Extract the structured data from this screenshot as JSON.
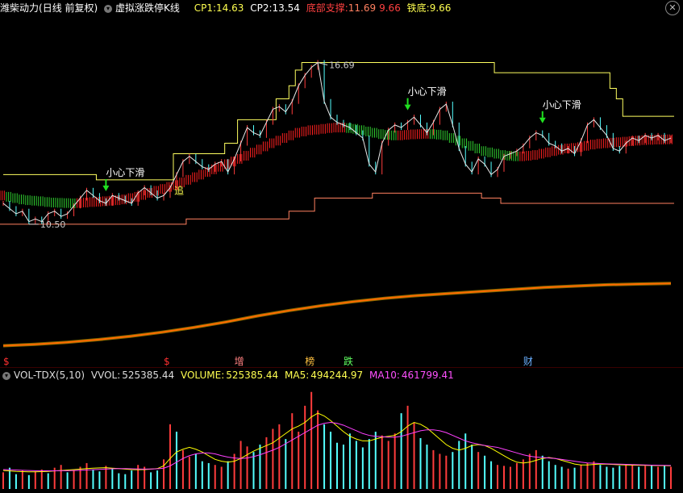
{
  "header": {
    "stock_name": "潍柴动力",
    "period": "(日线 前复权)",
    "indicator_name": "虚拟涨跌停K线",
    "cp1_label": "CP1:",
    "cp1_value": "14.63",
    "cp2_label": "CP2:",
    "cp2_value": "13.54",
    "support_label": "底部支撑:",
    "support_value1": "11.69",
    "support_value2": "9.66",
    "iron_label": "铁底:",
    "iron_value": "9.66"
  },
  "volume_header": {
    "title": "VOL-TDX(5,10)",
    "vvol_label": "VVOL:",
    "vvol_value": "525385.44",
    "volume_label": "VOLUME:",
    "volume_value": "525385.44",
    "ma5_label": "MA5:",
    "ma5_value": "494244.97",
    "ma10_label": "MA10:",
    "ma10_value": "461799.41"
  },
  "colors": {
    "up": "#ff3c3c",
    "down": "#54ffff",
    "ma_up": "#ff2020",
    "ma_down": "#30d030",
    "upper_band": "#ffff60",
    "lower_band": "#ff8060",
    "trend": "#ff6a00",
    "ma5": "#ffff00",
    "ma10": "#ff40ff"
  },
  "chart_data": [
    {
      "type": "line",
      "title": "虚拟涨跌停K线",
      "ylim": [
        9.2,
        17.6
      ],
      "grid": false,
      "price_series": [
        11.3,
        11.1,
        10.9,
        11.0,
        10.6,
        10.7,
        10.6,
        10.9,
        11.0,
        10.8,
        10.9,
        11.2,
        11.5,
        11.8,
        11.6,
        11.4,
        11.3,
        11.6,
        11.5,
        11.4,
        11.3,
        11.7,
        11.9,
        11.7,
        11.5,
        11.6,
        11.9,
        12.4,
        12.9,
        13.1,
        12.9,
        12.7,
        12.6,
        12.8,
        12.9,
        12.5,
        13.0,
        13.6,
        14.2,
        14.0,
        13.9,
        14.4,
        14.9,
        15.0,
        14.8,
        15.2,
        15.8,
        16.2,
        16.5,
        16.69,
        15.2,
        14.6,
        14.4,
        14.3,
        14.2,
        14.0,
        13.8,
        12.8,
        12.5,
        13.6,
        14.1,
        14.3,
        14.2,
        14.4,
        14.6,
        14.3,
        14.0,
        14.4,
        14.9,
        15.1,
        14.3,
        13.4,
        12.8,
        12.5,
        13.0,
        12.8,
        12.4,
        12.6,
        13.1,
        13.2,
        13.3,
        13.5,
        13.8,
        14.0,
        13.9,
        13.6,
        13.5,
        13.3,
        13.4,
        13.2,
        13.7,
        14.3,
        14.5,
        14.2,
        13.9,
        13.4,
        13.3,
        13.6,
        13.8,
        13.7,
        13.9,
        13.8,
        13.9,
        13.7,
        13.8
      ],
      "ma_series": [
        11.6,
        11.55,
        11.5,
        11.45,
        11.42,
        11.4,
        11.38,
        11.35,
        11.33,
        11.32,
        11.31,
        11.3,
        11.31,
        11.33,
        11.35,
        11.36,
        11.38,
        11.4,
        11.42,
        11.45,
        11.5,
        11.55,
        11.62,
        11.7,
        11.78,
        11.85,
        11.93,
        12.0,
        12.1,
        12.2,
        12.3,
        12.4,
        12.5,
        12.6,
        12.7,
        12.8,
        12.9,
        13.0,
        13.12,
        13.24,
        13.36,
        13.48,
        13.6,
        13.7,
        13.8,
        13.9,
        14.0,
        14.05,
        14.1,
        14.12,
        14.15,
        14.18,
        14.2,
        14.2,
        14.18,
        14.15,
        14.1,
        14.05,
        14.0,
        13.95,
        13.92,
        13.9,
        13.9,
        13.92,
        13.94,
        13.95,
        13.96,
        13.95,
        13.93,
        13.9,
        13.8,
        13.7,
        13.6,
        13.5,
        13.4,
        13.3,
        13.25,
        13.2,
        13.15,
        13.12,
        13.1,
        13.1,
        13.12,
        13.15,
        13.2,
        13.25,
        13.3,
        13.35,
        13.4,
        13.42,
        13.45,
        13.5,
        13.55,
        13.58,
        13.6,
        13.62,
        13.64,
        13.66,
        13.68,
        13.7,
        13.72,
        13.73,
        13.74,
        13.74,
        13.75
      ],
      "upper_band": [
        12.4,
        12.4,
        12.4,
        12.4,
        12.4,
        12.4,
        12.4,
        12.4,
        12.4,
        12.4,
        12.4,
        12.4,
        12.4,
        12.4,
        12.4,
        12.2,
        12.2,
        12.2,
        12.2,
        12.2,
        12.2,
        12.2,
        12.2,
        12.2,
        12.2,
        12.2,
        12.2,
        13.2,
        13.2,
        13.2,
        13.2,
        13.2,
        13.2,
        13.2,
        13.2,
        13.6,
        13.6,
        14.5,
        14.5,
        14.5,
        14.5,
        14.5,
        14.5,
        15.3,
        15.3,
        15.8,
        16.4,
        16.69,
        16.69,
        16.69,
        16.69,
        16.69,
        16.69,
        16.69,
        16.69,
        16.69,
        16.69,
        16.69,
        16.69,
        16.69,
        16.69,
        16.69,
        16.69,
        16.69,
        16.69,
        16.69,
        16.69,
        16.69,
        16.69,
        16.69,
        16.69,
        16.69,
        16.69,
        16.69,
        16.69,
        16.69,
        16.69,
        16.3,
        16.3,
        16.3,
        16.3,
        16.3,
        16.3,
        16.3,
        16.3,
        16.3,
        16.3,
        16.3,
        16.3,
        16.3,
        16.3,
        16.3,
        16.3,
        16.3,
        16.3,
        15.7,
        15.3,
        14.63,
        14.63,
        14.63,
        14.63,
        14.63,
        14.63,
        14.63,
        14.63
      ],
      "lower_band": [
        10.5,
        10.5,
        10.5,
        10.5,
        10.5,
        10.5,
        10.5,
        10.5,
        10.5,
        10.5,
        10.5,
        10.5,
        10.5,
        10.5,
        10.5,
        10.5,
        10.5,
        10.5,
        10.5,
        10.5,
        10.5,
        10.5,
        10.5,
        10.5,
        10.5,
        10.5,
        10.5,
        10.5,
        10.5,
        10.7,
        10.7,
        10.7,
        10.7,
        10.7,
        10.7,
        10.7,
        10.7,
        10.7,
        10.7,
        10.7,
        10.7,
        10.7,
        10.7,
        10.7,
        10.7,
        11.0,
        11.0,
        11.0,
        11.0,
        11.5,
        11.5,
        11.5,
        11.5,
        11.5,
        11.5,
        11.5,
        11.5,
        11.5,
        11.69,
        11.69,
        11.69,
        11.69,
        11.69,
        11.69,
        11.69,
        11.69,
        11.69,
        11.69,
        11.69,
        11.69,
        11.69,
        11.69,
        11.69,
        11.69,
        11.69,
        11.5,
        11.5,
        11.5,
        11.3,
        11.3,
        11.3,
        11.3,
        11.3,
        11.3,
        11.3,
        11.3,
        11.3,
        11.3,
        11.3,
        11.3,
        11.3,
        11.3,
        11.3,
        11.3,
        11.3,
        11.3,
        11.3,
        11.3,
        11.3,
        11.3,
        11.3,
        11.3,
        11.3,
        11.3,
        11.3
      ],
      "trend_ylim": [
        0,
        1
      ],
      "trend_series": [
        0.03,
        0.05,
        0.08,
        0.12,
        0.17,
        0.23,
        0.3,
        0.38,
        0.47,
        0.55,
        0.62,
        0.68,
        0.73,
        0.77,
        0.8,
        0.83,
        0.86,
        0.89,
        0.91,
        0.93,
        0.94,
        0.95
      ],
      "annotations": [
        {
          "text": "小心下滑",
          "index": 16,
          "arrow": true
        },
        {
          "text": "小心下滑",
          "index": 63,
          "arrow": true
        },
        {
          "text": "小心下滑",
          "index": 84,
          "arrow": true
        },
        {
          "text": "16.69",
          "index": 49
        },
        {
          "text": "10.50",
          "index": 4
        },
        {
          "text": "追",
          "index": 27
        }
      ],
      "event_markers": [
        {
          "text": "$",
          "index": 0,
          "color": "#ff3030"
        },
        {
          "text": "$",
          "index": 25,
          "color": "#ff3030"
        },
        {
          "text": "增",
          "index": 36,
          "color": "#ff8080"
        },
        {
          "text": "榜",
          "index": 47,
          "color": "#ffc040"
        },
        {
          "text": "跌",
          "index": 53,
          "color": "#60ff60"
        },
        {
          "text": "财",
          "index": 81,
          "color": "#6ab0ff"
        }
      ]
    },
    {
      "type": "bar",
      "title": "VOL-TDX(5,10)",
      "ylim": [
        0,
        1100000
      ],
      "volume": [
        180000,
        230000,
        160000,
        200000,
        150000,
        190000,
        210000,
        170000,
        230000,
        260000,
        180000,
        200000,
        240000,
        280000,
        210000,
        190000,
        250000,
        220000,
        170000,
        160000,
        200000,
        260000,
        240000,
        180000,
        200000,
        320000,
        700000,
        620000,
        420000,
        350000,
        380000,
        300000,
        280000,
        260000,
        240000,
        300000,
        380000,
        520000,
        460000,
        400000,
        480000,
        560000,
        650000,
        700000,
        540000,
        820000,
        620000,
        900000,
        1050000,
        850000,
        700000,
        620000,
        500000,
        480000,
        600000,
        520000,
        450000,
        540000,
        620000,
        580000,
        520000,
        600000,
        820000,
        900000,
        720000,
        550000,
        480000,
        420000,
        380000,
        360000,
        400000,
        520000,
        600000,
        480000,
        400000,
        360000,
        300000,
        260000,
        250000,
        240000,
        280000,
        320000,
        380000,
        420000,
        360000,
        300000,
        260000,
        240000,
        220000,
        230000,
        260000,
        280000,
        300000,
        260000,
        240000,
        230000,
        250000,
        270000,
        260000,
        240000,
        250000,
        260000,
        240000,
        255000,
        240000
      ],
      "up": [
        1,
        0,
        0,
        1,
        0,
        1,
        1,
        0,
        1,
        1,
        0,
        1,
        1,
        1,
        0,
        0,
        1,
        0,
        0,
        0,
        0,
        1,
        1,
        0,
        0,
        1,
        1,
        0,
        1,
        1,
        0,
        0,
        0,
        1,
        1,
        0,
        1,
        1,
        1,
        0,
        0,
        1,
        1,
        1,
        0,
        1,
        1,
        1,
        1,
        1,
        0,
        0,
        0,
        0,
        0,
        0,
        0,
        0,
        0,
        1,
        1,
        1,
        0,
        1,
        1,
        0,
        0,
        1,
        1,
        1,
        0,
        0,
        0,
        0,
        1,
        0,
        0,
        1,
        1,
        1,
        1,
        1,
        1,
        1,
        0,
        0,
        0,
        0,
        1,
        0,
        1,
        1,
        1,
        0,
        0,
        0,
        0,
        1,
        1,
        0,
        1,
        0,
        1,
        0,
        1
      ],
      "series": [
        {
          "name": "MA5",
          "values": [
            200000,
            195000,
            190000,
            188000,
            185000,
            186000,
            188000,
            190000,
            195000,
            200000,
            205000,
            210000,
            215000,
            220000,
            225000,
            228000,
            230000,
            225000,
            220000,
            215000,
            210000,
            208000,
            210000,
            215000,
            220000,
            250000,
            330000,
            400000,
            430000,
            450000,
            430000,
            400000,
            360000,
            320000,
            300000,
            290000,
            300000,
            330000,
            370000,
            410000,
            440000,
            470000,
            500000,
            550000,
            600000,
            650000,
            680000,
            720000,
            780000,
            820000,
            790000,
            740000,
            680000,
            620000,
            570000,
            540000,
            520000,
            520000,
            540000,
            560000,
            570000,
            580000,
            620000,
            680000,
            720000,
            700000,
            660000,
            600000,
            540000,
            480000,
            440000,
            420000,
            440000,
            470000,
            480000,
            470000,
            440000,
            400000,
            360000,
            320000,
            290000,
            280000,
            290000,
            310000,
            330000,
            340000,
            330000,
            310000,
            290000,
            270000,
            260000,
            260000,
            265000,
            270000,
            268000,
            265000,
            262000,
            260000,
            258000,
            256000,
            255000,
            254000,
            253000,
            252000,
            251000
          ]
        },
        {
          "name": "MA10",
          "values": [
            210000,
            208000,
            205000,
            202000,
            200000,
            198000,
            197000,
            196000,
            196000,
            197000,
            198000,
            200000,
            202000,
            205000,
            208000,
            212000,
            215000,
            218000,
            220000,
            220000,
            218000,
            216000,
            215000,
            216000,
            218000,
            225000,
            250000,
            290000,
            330000,
            360000,
            380000,
            390000,
            390000,
            380000,
            360000,
            345000,
            335000,
            330000,
            335000,
            350000,
            370000,
            395000,
            420000,
            450000,
            490000,
            530000,
            570000,
            610000,
            650000,
            690000,
            710000,
            720000,
            710000,
            690000,
            660000,
            630000,
            600000,
            580000,
            570000,
            565000,
            560000,
            560000,
            570000,
            590000,
            610000,
            630000,
            640000,
            640000,
            630000,
            610000,
            580000,
            550000,
            520000,
            500000,
            485000,
            470000,
            460000,
            450000,
            430000,
            410000,
            390000,
            370000,
            355000,
            345000,
            340000,
            335000,
            330000,
            320000,
            310000,
            300000,
            290000,
            282000,
            278000,
            275000,
            272000,
            270000,
            268000,
            266000,
            264000,
            262000,
            260000,
            258000,
            256000,
            255000,
            254000
          ]
        }
      ]
    }
  ]
}
